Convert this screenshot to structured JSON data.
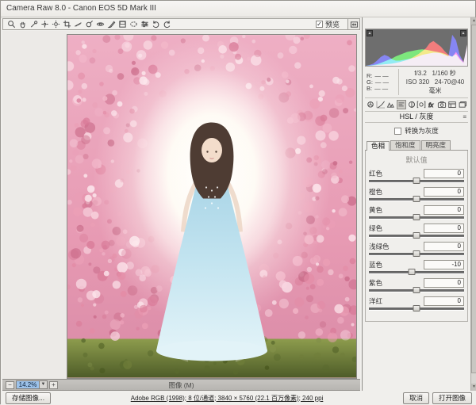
{
  "window": {
    "title": "Camera Raw 8.0 -  Canon EOS 5D Mark III"
  },
  "toolbar": {
    "tools": [
      "zoom",
      "hand",
      "white-balance",
      "color-sampler",
      "targeted-adjustment",
      "crop",
      "straighten",
      "spot-removal",
      "red-eye",
      "adjustment-brush",
      "graduated-filter",
      "radial-filter",
      "preferences",
      "rotate-left",
      "rotate-right"
    ],
    "preview_label": "预览",
    "preview_checked": true,
    "check_glyph": "✓"
  },
  "histogram": {
    "type": "histogram",
    "channels": {
      "red": [
        0,
        0,
        1,
        2,
        3,
        4,
        5,
        6,
        8,
        10,
        13,
        16,
        20,
        26,
        32,
        40,
        48,
        62,
        68,
        60,
        52,
        40,
        30,
        24,
        38,
        22,
        10,
        58
      ],
      "green": [
        0,
        1,
        2,
        4,
        8,
        12,
        16,
        20,
        26,
        30,
        34,
        38,
        40,
        42,
        44,
        45,
        44,
        42,
        40,
        38,
        36,
        33,
        28,
        26,
        32,
        18,
        8,
        58
      ],
      "blue": [
        0,
        2,
        6,
        14,
        24,
        30,
        26,
        18,
        14,
        14,
        16,
        18,
        20,
        22,
        26,
        30,
        32,
        34,
        36,
        36,
        34,
        30,
        26,
        85,
        70,
        30,
        10,
        58
      ]
    },
    "x_range": "0-255 tonal levels",
    "clipping_indicators": [
      "shadow-clipping",
      "highlight-clipping"
    ]
  },
  "exif": {
    "rgb_labels": [
      "R:",
      "G:",
      "B:"
    ],
    "rgb_value": "—  —",
    "aperture": "f/3.2",
    "shutter": "1/160 秒",
    "iso": "ISO 320",
    "lens": "24-70@40 毫米"
  },
  "panel": {
    "tab_icons": [
      "basic",
      "tone-curve",
      "detail",
      "hsl-grayscale",
      "split-toning",
      "lens-corrections",
      "effects",
      "camera-calibration",
      "presets",
      "snapshots"
    ],
    "selected_tab": "hsl-grayscale",
    "title": "HSL / 灰度",
    "menu_glyph": "≡",
    "grayscale_label": "转换为灰度",
    "grayscale_checked": false,
    "subtabs": [
      "色相",
      "饱和度",
      "明亮度"
    ],
    "selected_subtab": "色相",
    "default_link": "默认值",
    "sliders": [
      {
        "label": "红色",
        "value": "0",
        "pos": 50
      },
      {
        "label": "橙色",
        "value": "0",
        "pos": 50
      },
      {
        "label": "黄色",
        "value": "0",
        "pos": 50
      },
      {
        "label": "绿色",
        "value": "0",
        "pos": 50
      },
      {
        "label": "浅绿色",
        "value": "0",
        "pos": 50
      },
      {
        "label": "蓝色",
        "value": "-10",
        "pos": 45
      },
      {
        "label": "紫色",
        "value": "0",
        "pos": 50
      },
      {
        "label": "洋红",
        "value": "0",
        "pos": 50
      }
    ]
  },
  "statusbar": {
    "zoom_out": "−",
    "zoom_in": "+",
    "zoom_level": "14.2%",
    "dropdown_glyph": "▼",
    "caption": "图像 (M)"
  },
  "bottom": {
    "save_button": "存储图像...",
    "workflow_link": "Adobe RGB (1998); 8 位/通道; 3840 × 5760 (22.1 百万像素); 240 ppi",
    "cancel_button": "取消",
    "open_button": "打开图像"
  },
  "colors": {
    "selection_blue": "#9cc2ea",
    "histogram_bg": "#6e6e6e",
    "panel_bg": "#f0efec",
    "accent_red": "#e81b1b",
    "accent_green": "#1bd41b",
    "accent_blue": "#2a2ae8"
  }
}
